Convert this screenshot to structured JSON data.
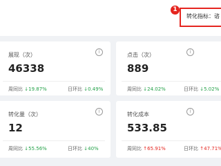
{
  "header": {
    "step_number": "1",
    "filter_label": "转化指标：",
    "filter_value": "谘"
  },
  "cards": [
    {
      "title": "展现（次）",
      "value": "46338",
      "wow_label": "周同比",
      "wow_value": "19.87%",
      "wow_dir": "down",
      "dod_label": "日环比",
      "dod_value": "0.49%",
      "dod_dir": "down"
    },
    {
      "title": "点击（次）",
      "value": "889",
      "wow_label": "周同比",
      "wow_value": "24.02%",
      "wow_dir": "down",
      "dod_label": "日环比",
      "dod_value": "5.02%",
      "dod_dir": "down"
    },
    {
      "title": "转化量（次）",
      "value": "12",
      "wow_label": "周同比",
      "wow_value": "55.56%",
      "wow_dir": "down",
      "dod_label": "日环比",
      "dod_value": "40%",
      "dod_dir": "down"
    },
    {
      "title": "转化成本",
      "value": "533.85",
      "wow_label": "周同比",
      "wow_value": "65.91%",
      "wow_dir": "up",
      "dod_label": "日环比",
      "dod_value": "47.71%",
      "dod_dir": "up"
    }
  ],
  "icons": {
    "info": "info-circle-icon",
    "arrow_down": "arrow-down-icon",
    "arrow_up": "arrow-up-icon"
  },
  "colors": {
    "down": "#24a148",
    "up": "#e5251f",
    "highlight": "#e5251f"
  }
}
